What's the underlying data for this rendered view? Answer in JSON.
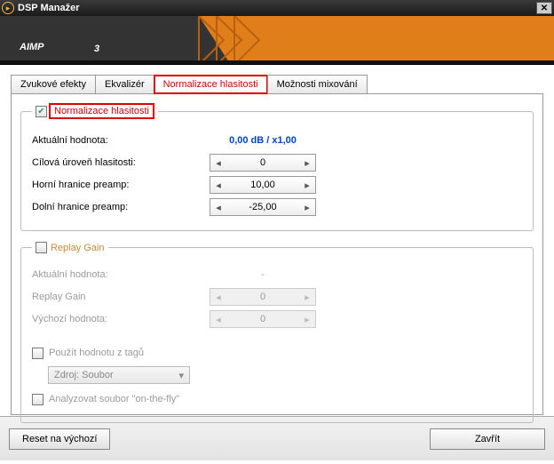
{
  "window": {
    "title": "DSP Manažer"
  },
  "logo": {
    "text": "AIMP",
    "sub": "3"
  },
  "tabs": {
    "sound_effects": "Zvukové efekty",
    "equalizer": "Ekvalizér",
    "normalization": "Normalizace hlasitosti",
    "mixing": "Možnosti mixování"
  },
  "norm": {
    "title": "Normalizace hlasitosti",
    "checked": true,
    "current_label": "Aktuální hodnota:",
    "current_value": "0,00 dB / x1,00",
    "target_label": "Cílová úroveň hlasitosti:",
    "target_value": "0",
    "upper_label": "Horní hranice preamp:",
    "upper_value": "10,00",
    "lower_label": "Dolní hranice preamp:",
    "lower_value": "-25,00"
  },
  "rg": {
    "title": "Replay Gain",
    "checked": false,
    "current_label": "Aktuální hodnota:",
    "current_value": "-",
    "rg_label": "Replay Gain",
    "rg_value": "0",
    "default_label": "Výchozí hodnota:",
    "default_value": "0",
    "use_tags_label": "Použít hodnotu z tagů",
    "source_label": "Zdroj: Soubor",
    "analyze_label": "Analyzovat soubor \"on-the-fly\""
  },
  "footer": {
    "reset": "Reset na výchozí",
    "close": "Zavřít"
  }
}
